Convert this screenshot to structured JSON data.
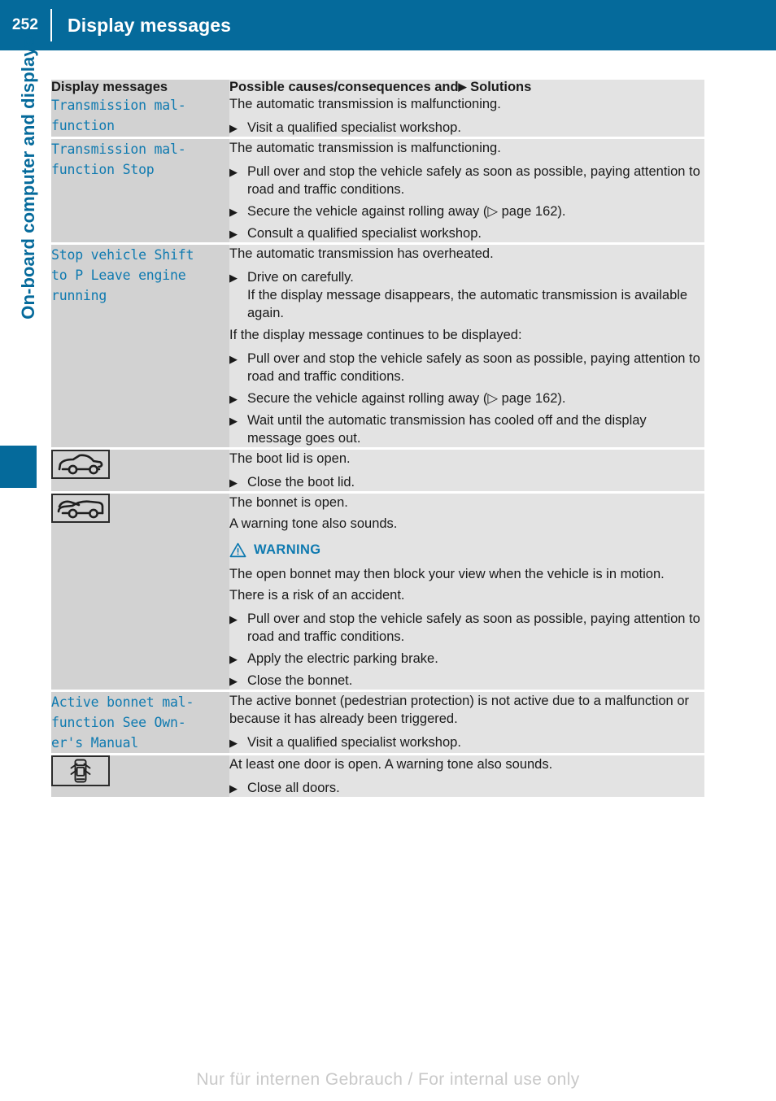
{
  "header": {
    "page_number": "252",
    "title": "Display messages"
  },
  "sidebar": {
    "chapter_title": "On-board computer and displays",
    "marker_color": "#056a9b"
  },
  "table": {
    "columns": {
      "left": "Display messages",
      "right_prefix": "Possible causes/consequences and",
      "right_arrow": "▶",
      "right_suffix": "Solutions"
    },
    "rows": [
      {
        "message": "Transmission mal-\nfunction",
        "icon": null,
        "blocks": [
          {
            "kind": "para",
            "text": "The automatic transmission is malfunctioning."
          },
          {
            "kind": "step",
            "text": "Visit a qualified specialist workshop."
          }
        ]
      },
      {
        "message": "Transmission mal-\nfunction Stop",
        "icon": null,
        "blocks": [
          {
            "kind": "para",
            "text": "The automatic transmission is malfunctioning."
          },
          {
            "kind": "step",
            "text": "Pull over and stop the vehicle safely as soon as possible, paying attention to road and traffic conditions."
          },
          {
            "kind": "step",
            "text": "Secure the vehicle against rolling away (▷ page 162)."
          },
          {
            "kind": "step",
            "text": "Consult a qualified specialist workshop."
          }
        ]
      },
      {
        "message": "Stop vehicle Shift\nto P Leave engine\nrunning",
        "icon": null,
        "blocks": [
          {
            "kind": "para",
            "text": "The automatic transmission has overheated."
          },
          {
            "kind": "step",
            "text": "Drive on carefully.",
            "sub": "If the display message disappears, the automatic transmission is available again."
          },
          {
            "kind": "para",
            "text": "If the display message continues to be displayed:"
          },
          {
            "kind": "step",
            "text": "Pull over and stop the vehicle safely as soon as possible, paying attention to road and traffic conditions."
          },
          {
            "kind": "step",
            "text": "Secure the vehicle against rolling away (▷ page 162)."
          },
          {
            "kind": "step",
            "text": "Wait until the automatic transmission has cooled off and the display message goes out."
          }
        ]
      },
      {
        "message": null,
        "icon": "car-boot-open-icon",
        "blocks": [
          {
            "kind": "para",
            "text": "The boot lid is open."
          },
          {
            "kind": "step",
            "text": "Close the boot lid."
          }
        ]
      },
      {
        "message": null,
        "icon": "car-bonnet-open-icon",
        "blocks": [
          {
            "kind": "para",
            "text": "The bonnet is open."
          },
          {
            "kind": "para",
            "text": "A warning tone also sounds."
          },
          {
            "kind": "warning",
            "label": "WARNING"
          },
          {
            "kind": "para",
            "text": "The open bonnet may then block your view when the vehicle is in motion."
          },
          {
            "kind": "para",
            "text": "There is a risk of an accident."
          },
          {
            "kind": "step",
            "text": "Pull over and stop the vehicle safely as soon as possible, paying attention to road and traffic conditions."
          },
          {
            "kind": "step",
            "text": "Apply the electric parking brake."
          },
          {
            "kind": "step",
            "text": "Close the bonnet."
          }
        ]
      },
      {
        "message": "Active bonnet mal-\nfunction See Own-\ner's Manual",
        "icon": null,
        "blocks": [
          {
            "kind": "para",
            "text": "The active bonnet (pedestrian protection) is not active due to a malfunction or because it has already been triggered."
          },
          {
            "kind": "step",
            "text": "Visit a qualified specialist workshop."
          }
        ]
      },
      {
        "message": null,
        "icon": "car-doors-open-icon",
        "blocks": [
          {
            "kind": "para",
            "text": "At least one door is open. A warning tone also sounds."
          },
          {
            "kind": "step",
            "text": "Close all doors."
          }
        ]
      }
    ]
  },
  "footer": {
    "note": "Nur für internen Gebrauch / For internal use only"
  },
  "colors": {
    "brand_blue": "#056a9b",
    "message_blue": "#0f7ab0",
    "left_cell_bg": "#d2d2d2",
    "right_cell_bg": "#e3e3e3"
  }
}
